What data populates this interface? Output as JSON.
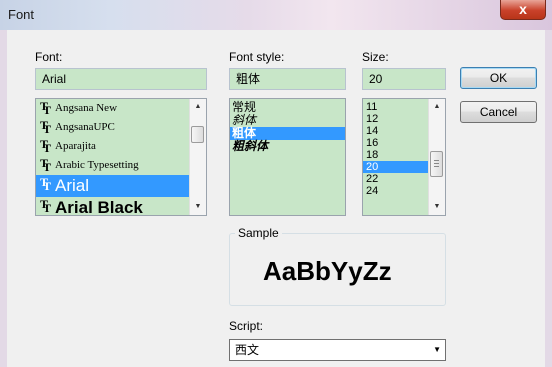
{
  "window": {
    "title": "Font",
    "close_glyph": "x"
  },
  "font": {
    "label": "Font:",
    "value": "Arial",
    "items": [
      {
        "name": "Angsana New"
      },
      {
        "name": "AngsanaUPC"
      },
      {
        "name": "Aparajita"
      },
      {
        "name": "Arabic Typesetting"
      },
      {
        "name": "Arial",
        "selected": true
      },
      {
        "name": "Arial Black"
      }
    ]
  },
  "style": {
    "label": "Font style:",
    "value": "粗体",
    "items": [
      {
        "name": "常规"
      },
      {
        "name": "斜体"
      },
      {
        "name": "粗体",
        "selected": true
      },
      {
        "name": "粗斜体"
      }
    ]
  },
  "size": {
    "label": "Size:",
    "value": "20",
    "items": [
      "11",
      "12",
      "14",
      "16",
      "18",
      "20",
      "22",
      "24"
    ],
    "selected": "20"
  },
  "buttons": {
    "ok": "OK",
    "cancel": "Cancel"
  },
  "sample": {
    "label": "Sample",
    "text": "AaBbYyZz"
  },
  "script": {
    "label": "Script:",
    "value": "西文"
  },
  "icons": {
    "truetype": "T",
    "scroll_up": "▲",
    "scroll_down": "▼",
    "dropdown": "▼"
  },
  "colors": {
    "field_bg": "#c8e6c8",
    "selection": "#3399ff",
    "close_button": "#c9412a"
  }
}
